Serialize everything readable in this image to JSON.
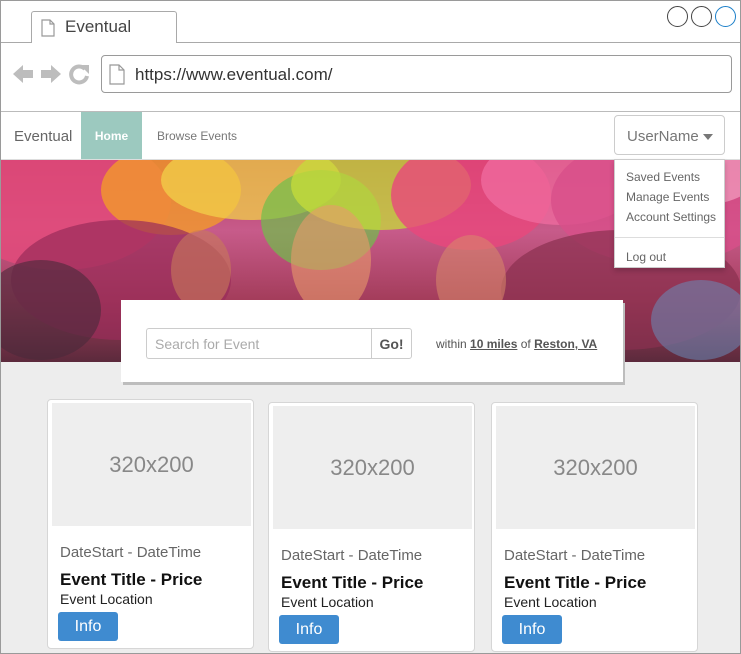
{
  "browser": {
    "tab_title": "Eventual",
    "url": "https://www.eventual.com/"
  },
  "nav": {
    "brand": "Eventual",
    "home": "Home",
    "browse": "Browse Events",
    "user": "UserName"
  },
  "user_menu": {
    "items": [
      "Saved Events",
      "Manage Events",
      "Account Settings"
    ],
    "logout": "Log out"
  },
  "search": {
    "placeholder": "Search for Event",
    "go": "Go!",
    "within_prefix": "within",
    "distance": "10 miles",
    "of_text": "of",
    "location": "Reston, VA"
  },
  "cards": [
    {
      "image": "320x200",
      "date": "DateStart - DateTime",
      "title": "Event Title - Price",
      "location": "Event Location",
      "button": "Info"
    },
    {
      "image": "320x200",
      "date": "DateStart - DateTime",
      "title": "Event Title - Price",
      "location": "Event Location",
      "button": "Info"
    },
    {
      "image": "320x200",
      "date": "DateStart - DateTime",
      "title": "Event Title - Price",
      "location": "Event Location",
      "button": "Info"
    }
  ],
  "colors": {
    "accent_home": "#9cc9bf",
    "info_button": "#3f8bd0",
    "content_bg": "#ededed"
  }
}
